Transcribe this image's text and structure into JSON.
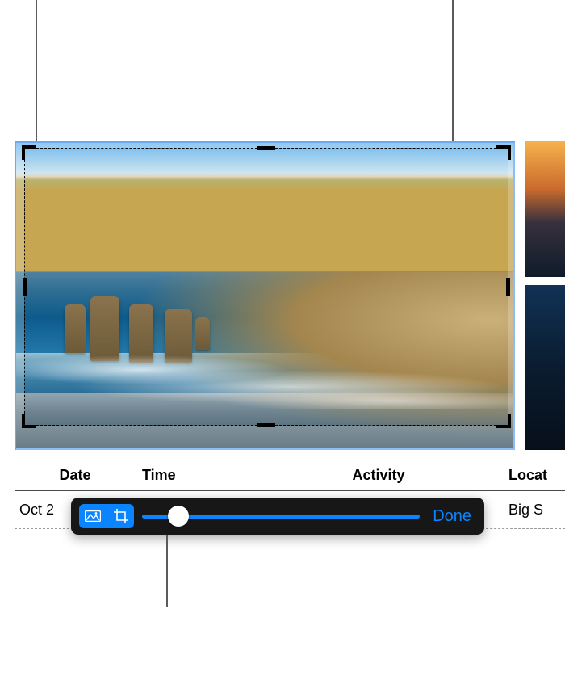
{
  "columns": {
    "date": "Date",
    "time": "Time",
    "activity": "Activity",
    "location": "Locat"
  },
  "row": {
    "date_visible": "Oct 2",
    "location_visible": "Big S"
  },
  "toolbar": {
    "done_label": "Done",
    "icons": {
      "mask": "mask-icon",
      "crop": "crop-icon"
    },
    "slider": {
      "min": 0,
      "max": 100,
      "value": 10
    }
  },
  "colors": {
    "accent": "#0a84ff",
    "toolbar_bg": "#171717"
  }
}
